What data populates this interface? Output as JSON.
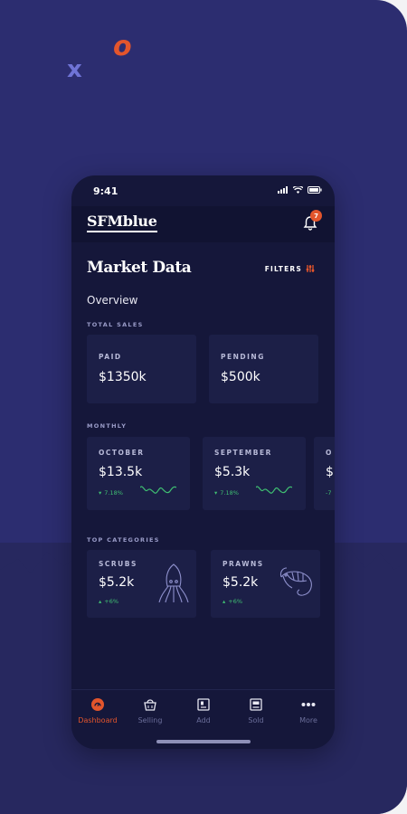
{
  "status": {
    "time": "9:41"
  },
  "app": {
    "logo": "SFMblue",
    "notifications": "7"
  },
  "page": {
    "title": "Market Data",
    "filters_label": "FILTERS",
    "overview_label": "Overview"
  },
  "total_sales": {
    "section_label": "TOTAL SALES",
    "items": [
      {
        "label": "PAID",
        "value": "$1350k"
      },
      {
        "label": "PENDING",
        "value": "$500k"
      }
    ]
  },
  "monthly": {
    "section_label": "MONTHLY",
    "items": [
      {
        "label": "OCTOBER",
        "value": "$13.5k",
        "delta": "7.18%",
        "trend_color": "#3fbf72"
      },
      {
        "label": "SEPTEMBER",
        "value": "$5.3k",
        "delta": "7.18%",
        "trend_color": "#3fbf72"
      },
      {
        "label": "O",
        "value": "$",
        "delta": "-7"
      }
    ]
  },
  "top_categories": {
    "section_label": "TOP CATEGORIES",
    "items": [
      {
        "label": "SCRUBS",
        "value": "$5.2k",
        "delta": "+6%",
        "icon": "squid-icon"
      },
      {
        "label": "PRAWNS",
        "value": "$5.2k",
        "delta": "+6%",
        "icon": "prawn-icon"
      }
    ]
  },
  "tabs": [
    {
      "label": "Dashboard",
      "icon": "dashboard-icon",
      "active": true
    },
    {
      "label": "Selling",
      "icon": "basket-icon",
      "active": false
    },
    {
      "label": "Add",
      "icon": "add-icon",
      "active": false
    },
    {
      "label": "Sold",
      "icon": "sold-icon",
      "active": false
    },
    {
      "label": "More",
      "icon": "more-icon",
      "active": false
    }
  ],
  "colors": {
    "accent": "#e3552c",
    "positive": "#3fbf72",
    "background": "#2c2d70",
    "phone_bg": "#15173a",
    "tile_bg": "#1c1f47"
  }
}
